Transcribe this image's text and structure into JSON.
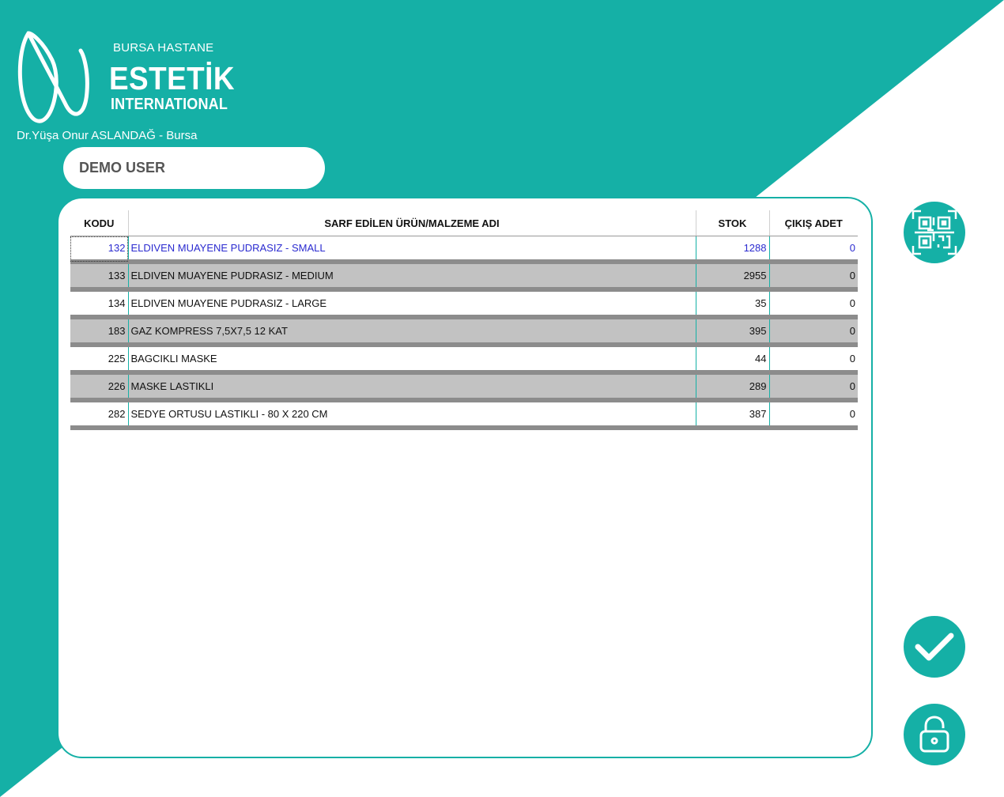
{
  "brand": {
    "hospital": "BURSA HASTANE",
    "name": "ESTETİK",
    "subtitle": "INTERNATIONAL",
    "doctor": "Dr.Yüşa Onur ASLANDAĞ - Bursa"
  },
  "user": {
    "name": "DEMO USER"
  },
  "colors": {
    "teal": "#15b0a6",
    "selected_text": "#2b2bd0",
    "row_alt": "#c2c2c2"
  },
  "table": {
    "headers": {
      "kodu": "KODU",
      "ad": "SARF EDİLEN ÜRÜN/MALZEME ADI",
      "stok": "STOK",
      "cikis": "ÇIKIŞ ADET"
    },
    "rows": [
      {
        "kodu": "132",
        "ad": "ELDIVEN MUAYENE PUDRASIZ - SMALL",
        "stok": "1288",
        "cikis": "0"
      },
      {
        "kodu": "133",
        "ad": "ELDIVEN MUAYENE PUDRASIZ - MEDIUM",
        "stok": "2955",
        "cikis": "0"
      },
      {
        "kodu": "134",
        "ad": "ELDIVEN MUAYENE PUDRASIZ - LARGE",
        "stok": "35",
        "cikis": "0"
      },
      {
        "kodu": "183",
        "ad": "GAZ KOMPRESS 7,5X7,5 12 KAT",
        "stok": "395",
        "cikis": "0"
      },
      {
        "kodu": "225",
        "ad": "BAGCIKLI MASKE",
        "stok": "44",
        "cikis": "0"
      },
      {
        "kodu": "226",
        "ad": "MASKE LASTIKLI",
        "stok": "289",
        "cikis": "0"
      },
      {
        "kodu": "282",
        "ad": "SEDYE ORTUSU LASTIKLI - 80 X 220 CM",
        "stok": "387",
        "cikis": "0"
      }
    ]
  },
  "icons": {
    "qr": "qr-code-icon",
    "confirm": "checkmark-icon",
    "lock": "unlock-icon"
  }
}
